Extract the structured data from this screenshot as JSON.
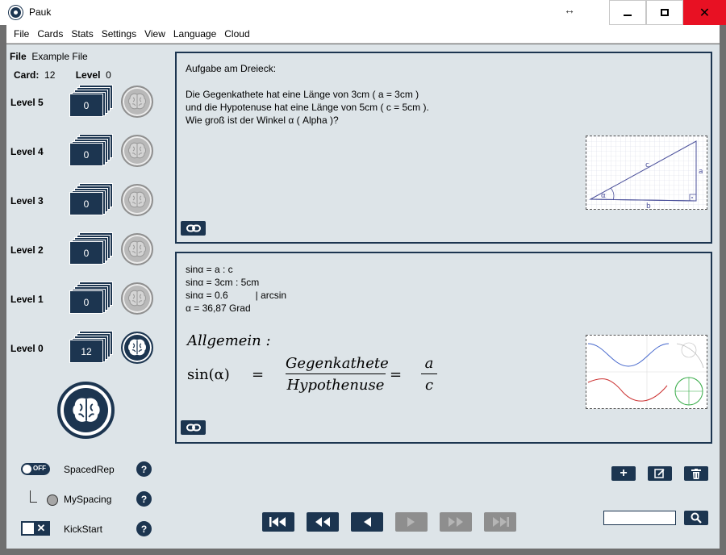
{
  "window": {
    "title": "Pauk",
    "resize_icon": "double-arrow-icon",
    "close_glyph": "✕"
  },
  "menu": [
    "File",
    "Cards",
    "Stats",
    "Settings",
    "View",
    "Language",
    "Cloud"
  ],
  "sidebar": {
    "file_label": "File",
    "file_name": "Example File",
    "card_label": "Card:",
    "card_value": "12",
    "level_label": "Level",
    "level_value": "0",
    "levels": [
      {
        "label": "Level 5",
        "count": "0",
        "active": false
      },
      {
        "label": "Level 4",
        "count": "0",
        "active": false
      },
      {
        "label": "Level 3",
        "count": "0",
        "active": false
      },
      {
        "label": "Level 2",
        "count": "0",
        "active": false
      },
      {
        "label": "Level 1",
        "count": "0",
        "active": false
      },
      {
        "label": "Level 0",
        "count": "12",
        "active": true
      }
    ],
    "options": {
      "spacedrep_toggle": "OFF",
      "spacedrep_label": "SpacedRep",
      "myspacing_label": "MySpacing",
      "kickstart_label": "KickStart",
      "help_glyph": "?",
      "kickstart_x": "✕"
    }
  },
  "question": {
    "line1": "Aufgabe am Dreieck:",
    "line2": "Die Gegenkathete hat eine Länge von 3cm ( a = 3cm )",
    "line3": "und die Hypotenuse hat eine Länge von 5cm ( c = 5cm ).",
    "line4": "Wie groß ist der Winkel α ( Alpha )?",
    "image_labels": {
      "c": "c",
      "a": "a",
      "b": "b",
      "alpha": "α"
    }
  },
  "answer": {
    "line1": "sinα = a : c",
    "line2": "sinα = 3cm : 5cm",
    "line3": "sinα = 0.6",
    "line3_note": "| arcsin",
    "line4": "α = 36,87 Grad",
    "formula": {
      "heading": "Allgemein :",
      "lhs": "sin(α)",
      "eq": "=",
      "num": "Gegenkathete",
      "den": "Hypothenuse",
      "num2": "a",
      "den2": "c"
    }
  },
  "actions": {
    "add_glyph": "+"
  },
  "search": {
    "placeholder": ""
  },
  "colors": {
    "accent": "#1c3550",
    "panel_bg": "#dde4e8",
    "disabled": "#8e8e8e"
  }
}
